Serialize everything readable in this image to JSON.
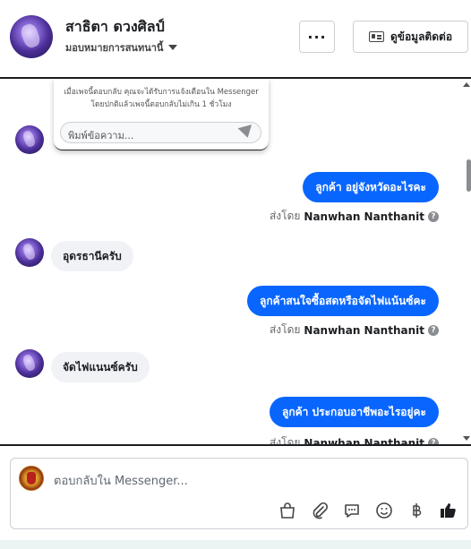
{
  "header": {
    "name": "สาธิตา ดวงศิลป์",
    "subtitle": "มอบหมายการสนทนานี้",
    "more_label": "···",
    "contact_label": "ดูข้อมูลติดต่อ"
  },
  "popup": {
    "text": "เมื่อเพจนี้ตอบกลับ คุณจะได้รับการแจ้งเตือนใน Messenger โดยปกติแล้วเพจนี้ตอบกลับไม่เกิน 1 ชั่วโมง",
    "placeholder": "พิมพ์ข้อความ..."
  },
  "messages": [
    {
      "type": "out",
      "text": "ลูกค้า   อยู่จังหวัดอะไรคะ",
      "sent_by_prefix": "ส่งโดย",
      "sent_by_name": "Nanwhan Nanthanit"
    },
    {
      "type": "in",
      "text": "อุดรธานีครับ"
    },
    {
      "type": "out",
      "text": "ลูกค้าสนใจซื้อสดหรือจัดไฟแน้นซ์คะ",
      "sent_by_prefix": "ส่งโดย",
      "sent_by_name": "Nanwhan Nanthanit"
    },
    {
      "type": "in",
      "text": "จัดไฟแนนซ์ครับ"
    },
    {
      "type": "out",
      "text": "ลูกค้า  ประกอบอาชีพอะไรอยู่คะ",
      "sent_by_prefix": "ส่งโดย",
      "sent_by_name": "Nanwhan Nanthanit"
    }
  ],
  "composer": {
    "placeholder": "ตอบกลับใน Messenger...",
    "tools": [
      "bag-icon",
      "paperclip-icon",
      "message-icon",
      "emoji-icon",
      "baht-icon",
      "thumbs-up-icon"
    ]
  },
  "colors": {
    "accent": "#0866ff",
    "incoming_bubble": "#f0f2f5",
    "thumbs_up": "#1c1e21"
  }
}
